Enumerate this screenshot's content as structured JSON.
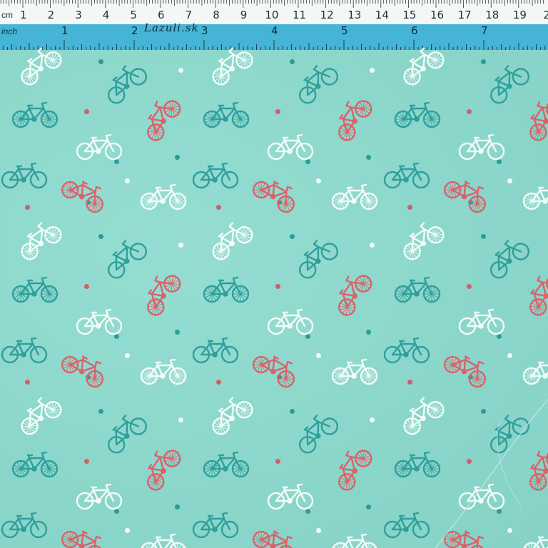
{
  "ruler": {
    "cm_unit": "cm",
    "cm_numbers": [
      "1",
      "2",
      "3",
      "4",
      "5",
      "6",
      "7",
      "8",
      "9",
      "10",
      "11",
      "12",
      "13",
      "14",
      "15",
      "16",
      "17",
      "18",
      "19",
      "2"
    ],
    "inch_unit": "inch",
    "inch_numbers": [
      "1",
      "2",
      "3",
      "4",
      "5",
      "6",
      "7"
    ],
    "brand": "Lazuli.sk"
  },
  "colors": {
    "fabric": "#8ed8cc",
    "teal_bike": "#2f9f9d",
    "white_bike": "#f3fbf8",
    "coral_bike": "#d9636a",
    "ruler_blue": "#45b4d6"
  },
  "print": {
    "motif": "bicycle",
    "bike_colors": [
      "teal",
      "white",
      "coral"
    ],
    "dot_colors": [
      "teal",
      "white",
      "coral"
    ]
  }
}
